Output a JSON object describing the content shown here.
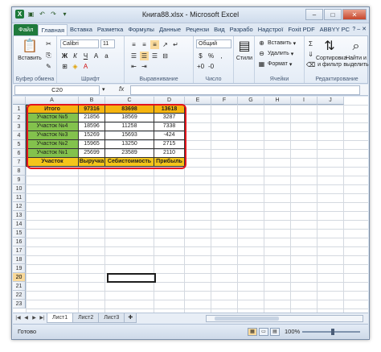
{
  "window": {
    "title": "Книга88.xlsx - Microsoft Excel"
  },
  "tabs": [
    "Файл",
    "Главная",
    "Вставка",
    "Разметка",
    "Формулы",
    "Данные",
    "Рецензи",
    "Вид",
    "Разрабо",
    "Надстрої",
    "Foxit PDF",
    "ABBYY PC"
  ],
  "ribbon": {
    "paste_label": "Вставить",
    "font_name": "Calibri",
    "font_size": "11",
    "number_format": "Общий",
    "styles_label": "Стили",
    "insert_label": "Вставить",
    "delete_label": "Удалить",
    "format_label": "Формат",
    "sort_label": "Сортировка и фильтр",
    "find_label": "Найти и выделить",
    "groups": {
      "clipboard": "Буфер обмена",
      "font": "Шрифт",
      "align": "Выравнивание",
      "number": "Число",
      "cells": "Ячейки",
      "edit": "Редактирование"
    }
  },
  "formula_bar": {
    "name_box": "C20",
    "fx": "fx",
    "formula": ""
  },
  "sheet": {
    "columns": [
      "A",
      "B",
      "C",
      "D",
      "E",
      "F",
      "G",
      "H",
      "I",
      "J"
    ],
    "row_numbers": [
      "1",
      "2",
      "3",
      "4",
      "5",
      "6",
      "7",
      "8",
      "9",
      "10",
      "11",
      "12",
      "13",
      "14",
      "15",
      "16",
      "17",
      "18",
      "19",
      "20",
      "21",
      "22",
      "23"
    ],
    "table": [
      [
        "Итого",
        "97316",
        "83698",
        "13618"
      ],
      [
        "Участок №5",
        "21856",
        "18569",
        "3287"
      ],
      [
        "Участок №4",
        "18596",
        "11258",
        "7338"
      ],
      [
        "Участок №3",
        "15269",
        "15693",
        "-424"
      ],
      [
        "Участок №2",
        "15965",
        "13250",
        "2715"
      ],
      [
        "Участок №1",
        "25699",
        "23589",
        "2110"
      ],
      [
        "Участок",
        "Выручка",
        "Себистоимость",
        "Прибыль"
      ]
    ]
  },
  "sheet_tabs": [
    "Лист1",
    "Лист2",
    "Лист3"
  ],
  "status": {
    "ready": "Готово",
    "zoom": "100%"
  }
}
